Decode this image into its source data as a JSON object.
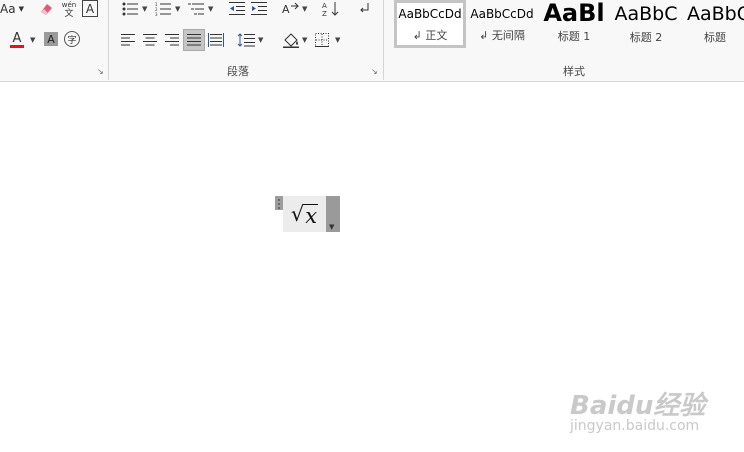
{
  "ribbon": {
    "font_group": {
      "change_case_label": "Aa",
      "phonetic_top": "wén",
      "phonetic_bottom": "文",
      "char_border_label": "A",
      "font_color_label": "A",
      "shading_label": "A",
      "enclose_label": "字"
    },
    "paragraph_group": {
      "label": "段落"
    },
    "styles_group": {
      "label": "样式",
      "styles": [
        {
          "sample": "AaBbCcDd",
          "name": "正文",
          "mark": "↲",
          "selected": true
        },
        {
          "sample": "AaBbCcDd",
          "name": "无间隔",
          "mark": "↲",
          "selected": false
        },
        {
          "sample": "AaBl",
          "name": "标题 1",
          "mark": "",
          "selected": false
        },
        {
          "sample": "AaBbC",
          "name": "标题 2",
          "mark": "",
          "selected": false
        },
        {
          "sample": "AaBbC",
          "name": "标题",
          "mark": "",
          "selected": false
        }
      ]
    },
    "colors": {
      "font_color_bar": "#e81123",
      "active_button": "#c5c5c5"
    }
  },
  "equation": {
    "radical": "√",
    "variable": "x"
  },
  "watermark": {
    "brand": "Baidu经验",
    "url": "jingyan.baidu.com"
  }
}
